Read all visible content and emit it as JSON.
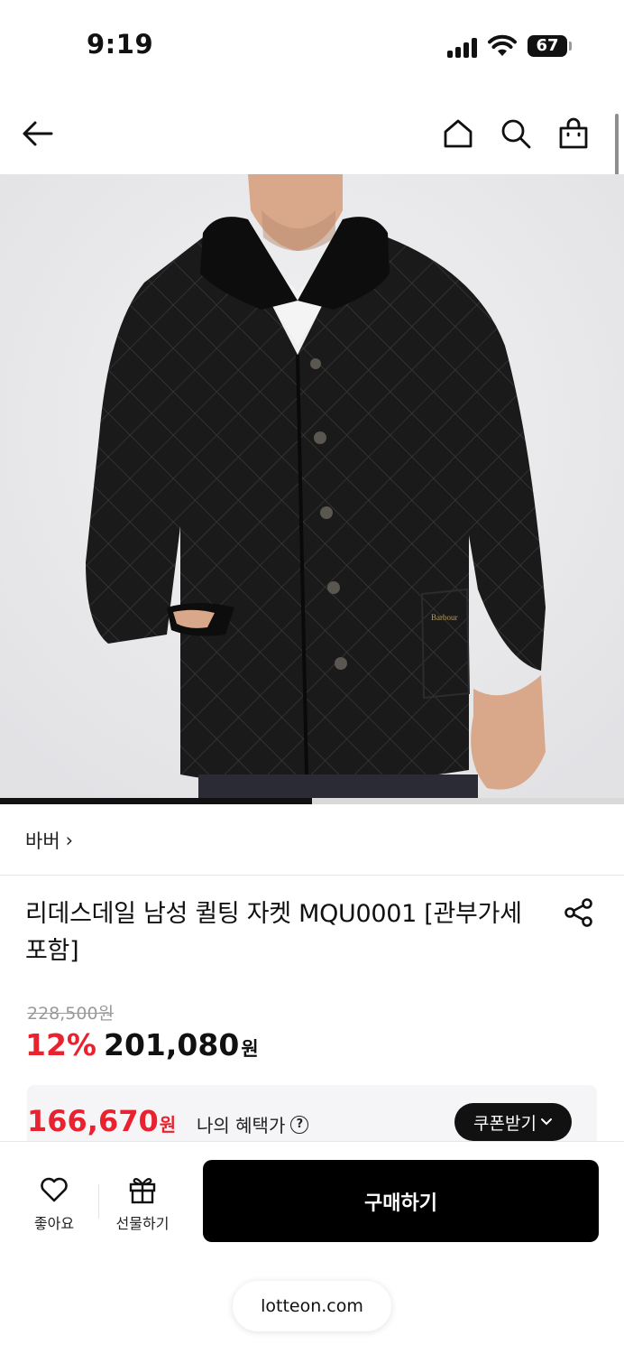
{
  "status_bar": {
    "time": "9:19",
    "battery": "67"
  },
  "nav": {
    "back_icon": "arrow-left-icon",
    "home_icon": "home-icon",
    "search_icon": "search-icon",
    "cart_icon": "shopping-bag-icon"
  },
  "hero": {
    "image_description": "Man wearing black diamond-quilted jacket with corduroy collar",
    "carousel_progress": 0.5
  },
  "brand": {
    "name": "바버",
    "chevron": "›"
  },
  "product": {
    "title": "리데스데일 남성 퀼팅 자켓 MQU0001 [관부가세 포함]",
    "share_icon": "share-icon"
  },
  "price": {
    "original": "228,500원",
    "discount": "12%",
    "sale": "201,080",
    "unit": "원"
  },
  "benefit": {
    "price": "166,670",
    "unit": "원",
    "label": "나의 혜택가",
    "help": "?",
    "coupon_label": "쿠폰받기"
  },
  "bottom_bar": {
    "like_label": "좋아요",
    "gift_label": "선물하기",
    "buy_label": "구매하기"
  },
  "browser": {
    "url": "lotteon.com"
  },
  "colors": {
    "accent_red": "#e8232f",
    "primary_black": "#000000",
    "benefit_bg": "#f5f5f7"
  }
}
